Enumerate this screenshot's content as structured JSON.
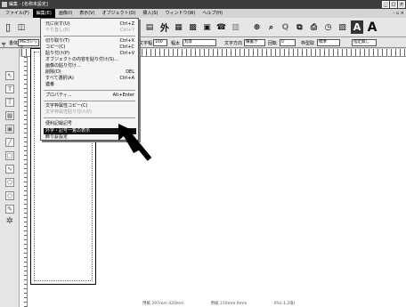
{
  "window": {
    "title": "編集 - [名称未設定]"
  },
  "menubar": [
    "ファイル(F)",
    "編集(E)",
    "画像(I)",
    "表示(V)",
    "オブジェクト(O)",
    "挿入(S)",
    "ウィンドウ(W)",
    "ヘルプ(H)"
  ],
  "toolbar2": {
    "style_label": "書体",
    "style_value": "MSゴシック",
    "size_label": "文字幅",
    "size_value": "100",
    "format_label": "幅太",
    "format_value": "丸等",
    "dir_label": "文字方向",
    "dir_value": "横書き",
    "rot_label": "回転",
    "rot_value": "0",
    "frame_label": "枠型取",
    "frame_value": "標準",
    "spec_label": "指定無し"
  },
  "edit_menu": {
    "items": [
      {
        "label": "元に戻す(U)",
        "shortcut": "Ctrl+Z"
      },
      {
        "label": "やり直し(R)",
        "shortcut": "Ctrl+Y"
      },
      {
        "label": "切り取り(T)",
        "shortcut": "Ctrl+X"
      },
      {
        "label": "コピー(C)",
        "shortcut": "Ctrl+C"
      },
      {
        "label": "貼り付け(P)",
        "shortcut": "Ctrl+V"
      },
      {
        "label": "オブジェクトの内容を貼り付け(S)...",
        "shortcut": ""
      },
      {
        "label": "画像の貼り付け...",
        "shortcut": ""
      },
      {
        "label": "削除(D)",
        "shortcut": "DEL"
      },
      {
        "label": "すべて選択(A)",
        "shortcut": "Ctrl+A"
      },
      {
        "label": "連番",
        "shortcut": ""
      },
      {
        "label": "プロパティ...",
        "shortcut": "Alt+Enter"
      },
      {
        "label": "文字枠属性コピー(C)",
        "shortcut": ""
      },
      {
        "label": "文字枠属性貼り付け(P)",
        "shortcut": ""
      },
      {
        "label": "便利記録記号",
        "shortcut": ""
      },
      {
        "label": "外字・記号一覧の表示",
        "shortcut": ""
      },
      {
        "label": "飾り罫設定",
        "shortcut": ""
      }
    ]
  },
  "status": {
    "pos": "用紙 297mm 420mm",
    "cursor": "用紙 210mm 0mm",
    "zoom": "0%(-1.2倍)"
  }
}
